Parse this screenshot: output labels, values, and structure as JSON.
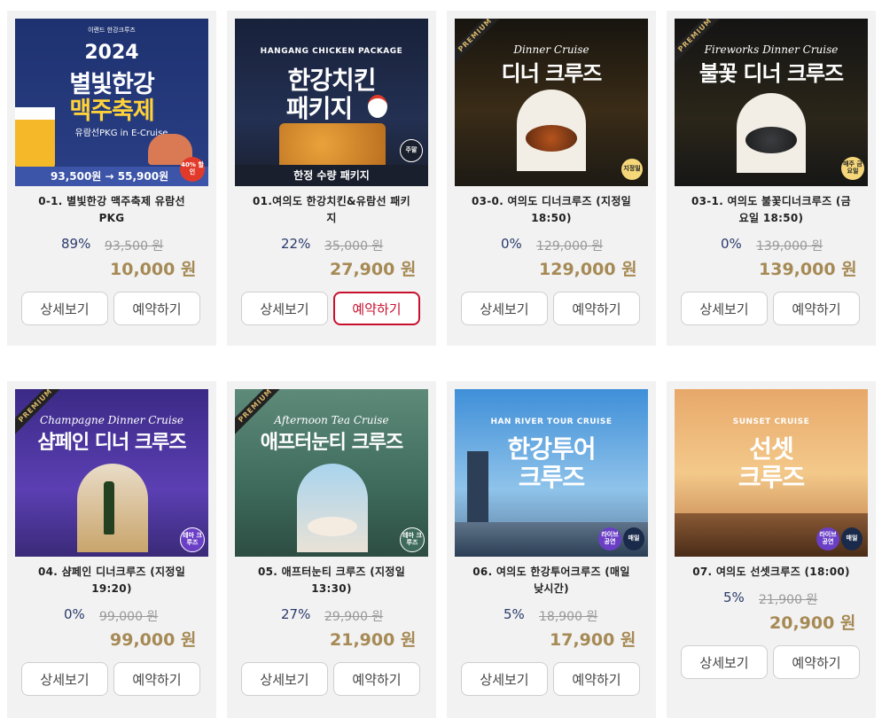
{
  "products": [
    {
      "title_line1": "0-1. 별빛한강 맥주축제 유람선",
      "title_line2": "PKG",
      "discount": "89%",
      "original_price": "93,500 원",
      "price": "10,000 원",
      "thumb": {
        "brand": "이랜드 한강크루즈",
        "year": "2024",
        "headline1": "별빛한강",
        "headline2": "맥주축제",
        "sub": "유람선PKG in E-Cruise",
        "price_strip": "93,500원 → 55,900원",
        "badge": "40% 할인"
      }
    },
    {
      "title_line1": "01.여의도 한강치킨&유람선 패키",
      "title_line2": "지",
      "discount": "22%",
      "original_price": "35,000 원",
      "price": "27,900 원",
      "thumb": {
        "en": "HANGANG CHICKEN PACKAGE",
        "headline1": "한강치킨",
        "headline2": "패키지",
        "strip": "한정 수량 패키지",
        "badge": "주말"
      }
    },
    {
      "title_line1": "03-0. 여의도 디너크루즈 (지정일",
      "title_line2": "18:50)",
      "discount": "0%",
      "original_price": "129,000 원",
      "price": "129,000 원",
      "thumb": {
        "ribbon": "PREMIUM",
        "script": "Dinner Cruise",
        "headline1": "디너 크루즈",
        "badge": "지정일"
      }
    },
    {
      "title_line1": "03-1. 여의도 불꽃디너크루즈 (금",
      "title_line2": "요일 18:50)",
      "discount": "0%",
      "original_price": "139,000 원",
      "price": "139,000 원",
      "thumb": {
        "ribbon": "PREMIUM",
        "script": "Fireworks Dinner Cruise",
        "headline1": "불꽃 디너 크루즈",
        "badge": "매주 금요일"
      }
    },
    {
      "title_line1": "04. 샴페인 디너크루즈 (지정일",
      "title_line2": "19:20)",
      "discount": "0%",
      "original_price": "99,000 원",
      "price": "99,000 원",
      "thumb": {
        "ribbon": "PREMIUM",
        "script": "Champagne Dinner Cruise",
        "headline1": "샴페인 디너 크루즈",
        "badge": "테마 크루즈"
      }
    },
    {
      "title_line1": "05. 애프터눈티 크루즈 (지정일",
      "title_line2": "13:30)",
      "discount": "27%",
      "original_price": "29,900 원",
      "price": "21,900 원",
      "thumb": {
        "ribbon": "PREMIUM",
        "script": "Afternoon Tea Cruise",
        "headline1": "애프터눈티 크루즈",
        "badge": "테마 크루즈"
      }
    },
    {
      "title_line1": "06. 여의도 한강투어크루즈 (매일",
      "title_line2": "낮시간)",
      "discount": "5%",
      "original_price": "18,900 원",
      "price": "17,900 원",
      "thumb": {
        "en": "HAN RIVER TOUR CRUISE",
        "headline1": "한강투어",
        "headline2": "크루즈",
        "badge1": "라이브 공연",
        "badge2": "매일"
      }
    },
    {
      "title_line1": "07. 여의도 선셋크루즈 (18:00)",
      "title_line2": "",
      "discount": "5%",
      "original_price": "21,900 원",
      "price": "20,900 원",
      "thumb": {
        "en": "SUNSET CRUISE",
        "headline1": "선셋",
        "headline2": "크루즈",
        "badge1": "라이브 공연",
        "badge2": "매일"
      }
    }
  ],
  "buttons": {
    "detail": "상세보기",
    "reserve": "예약하기"
  }
}
